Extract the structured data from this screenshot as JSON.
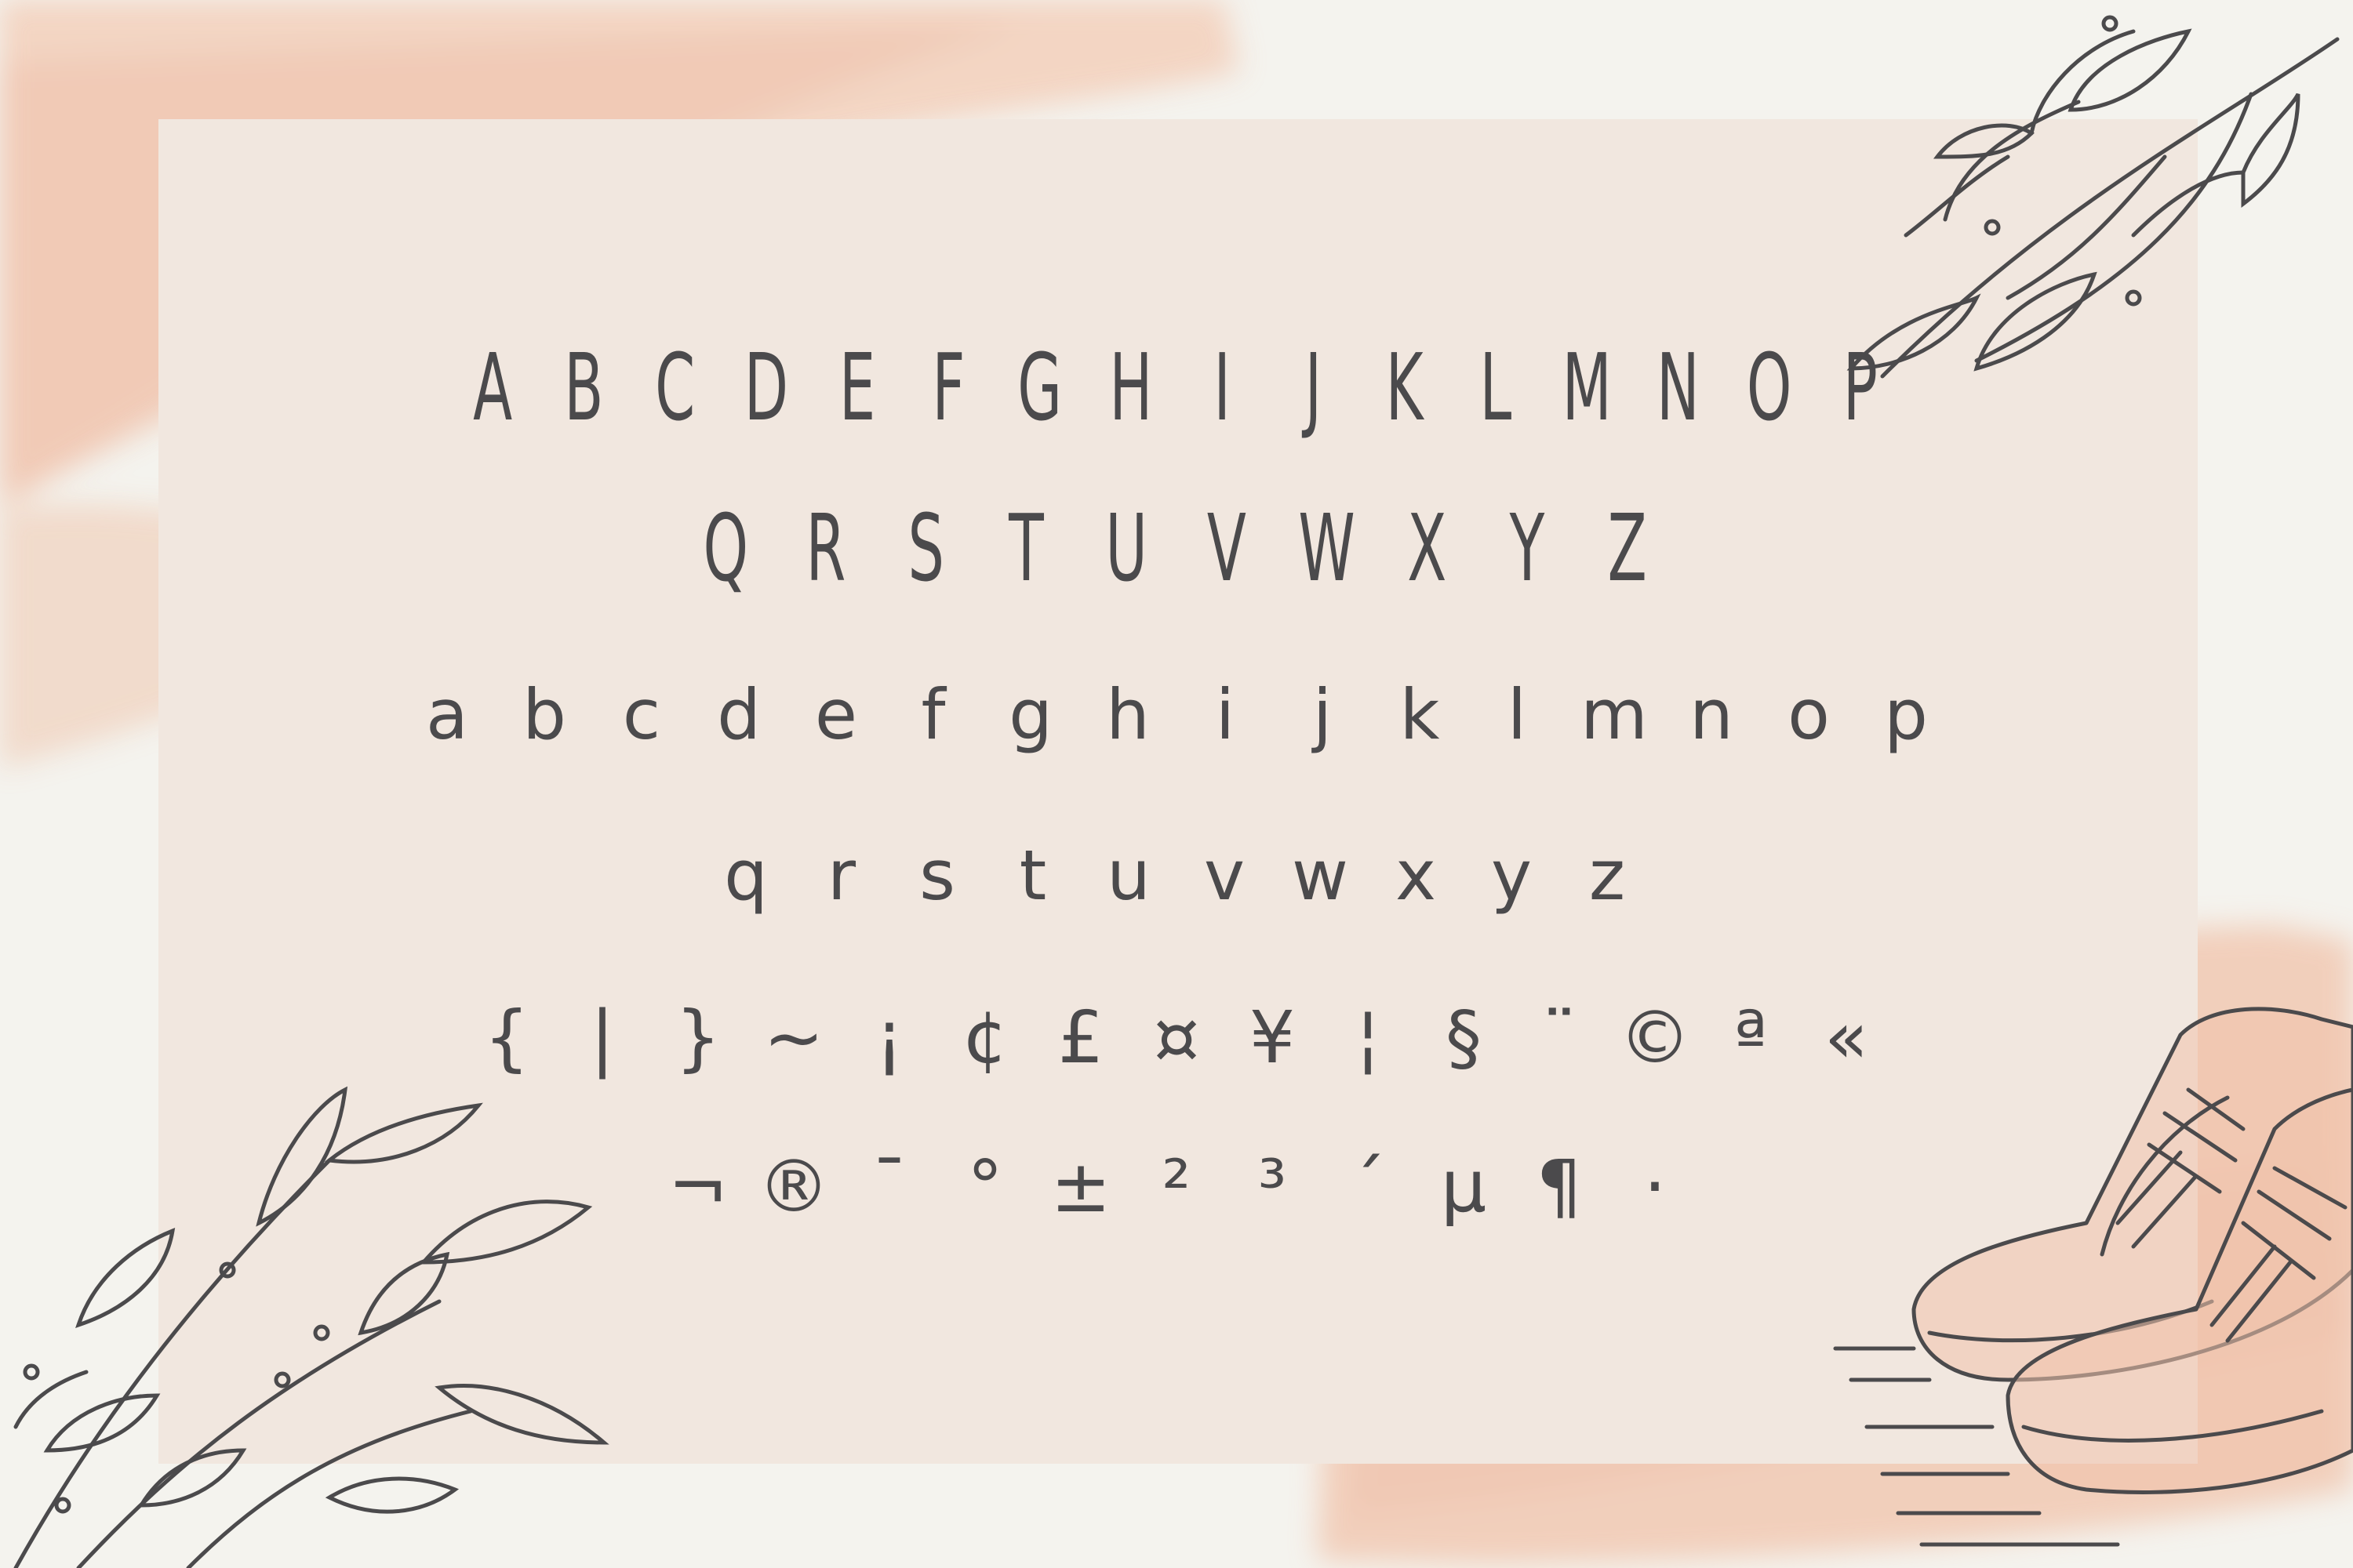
{
  "palette": {
    "background": "#f4f3ee",
    "panel": "#f1e7df",
    "ink": "#4b4a4c",
    "watercolor": "#eeb79c"
  },
  "illustrations": [
    "leaf-branch-top-right",
    "leaf-branch-bottom-left",
    "sneakers-drawing"
  ],
  "charset": {
    "upper_row_1": [
      "A",
      "B",
      "C",
      "D",
      "E",
      "F",
      "G",
      "H",
      "I",
      "J",
      "K",
      "L",
      "M",
      "N",
      "O",
      "P"
    ],
    "upper_row_2": [
      "Q",
      "R",
      "S",
      "T",
      "U",
      "V",
      "W",
      "X",
      "Y",
      "Z"
    ],
    "lower_row_1": [
      "a",
      "b",
      "c",
      "d",
      "e",
      "f",
      "g",
      "h",
      "i",
      "j",
      "k",
      "l",
      "m",
      "n",
      "o",
      "p"
    ],
    "lower_row_2": [
      "q",
      "r",
      "s",
      "t",
      "u",
      "v",
      "w",
      "x",
      "y",
      "z"
    ],
    "symbols_row_1": [
      "{",
      "|",
      "}",
      "~",
      "¡",
      "¢",
      "£",
      "¤",
      "¥",
      "¦",
      "§",
      "¨",
      "©",
      "ª",
      "«"
    ],
    "symbols_row_2": [
      "¬",
      "®",
      "¯",
      "°",
      "±",
      "²",
      "³",
      "´",
      "µ",
      "¶",
      "·"
    ]
  }
}
